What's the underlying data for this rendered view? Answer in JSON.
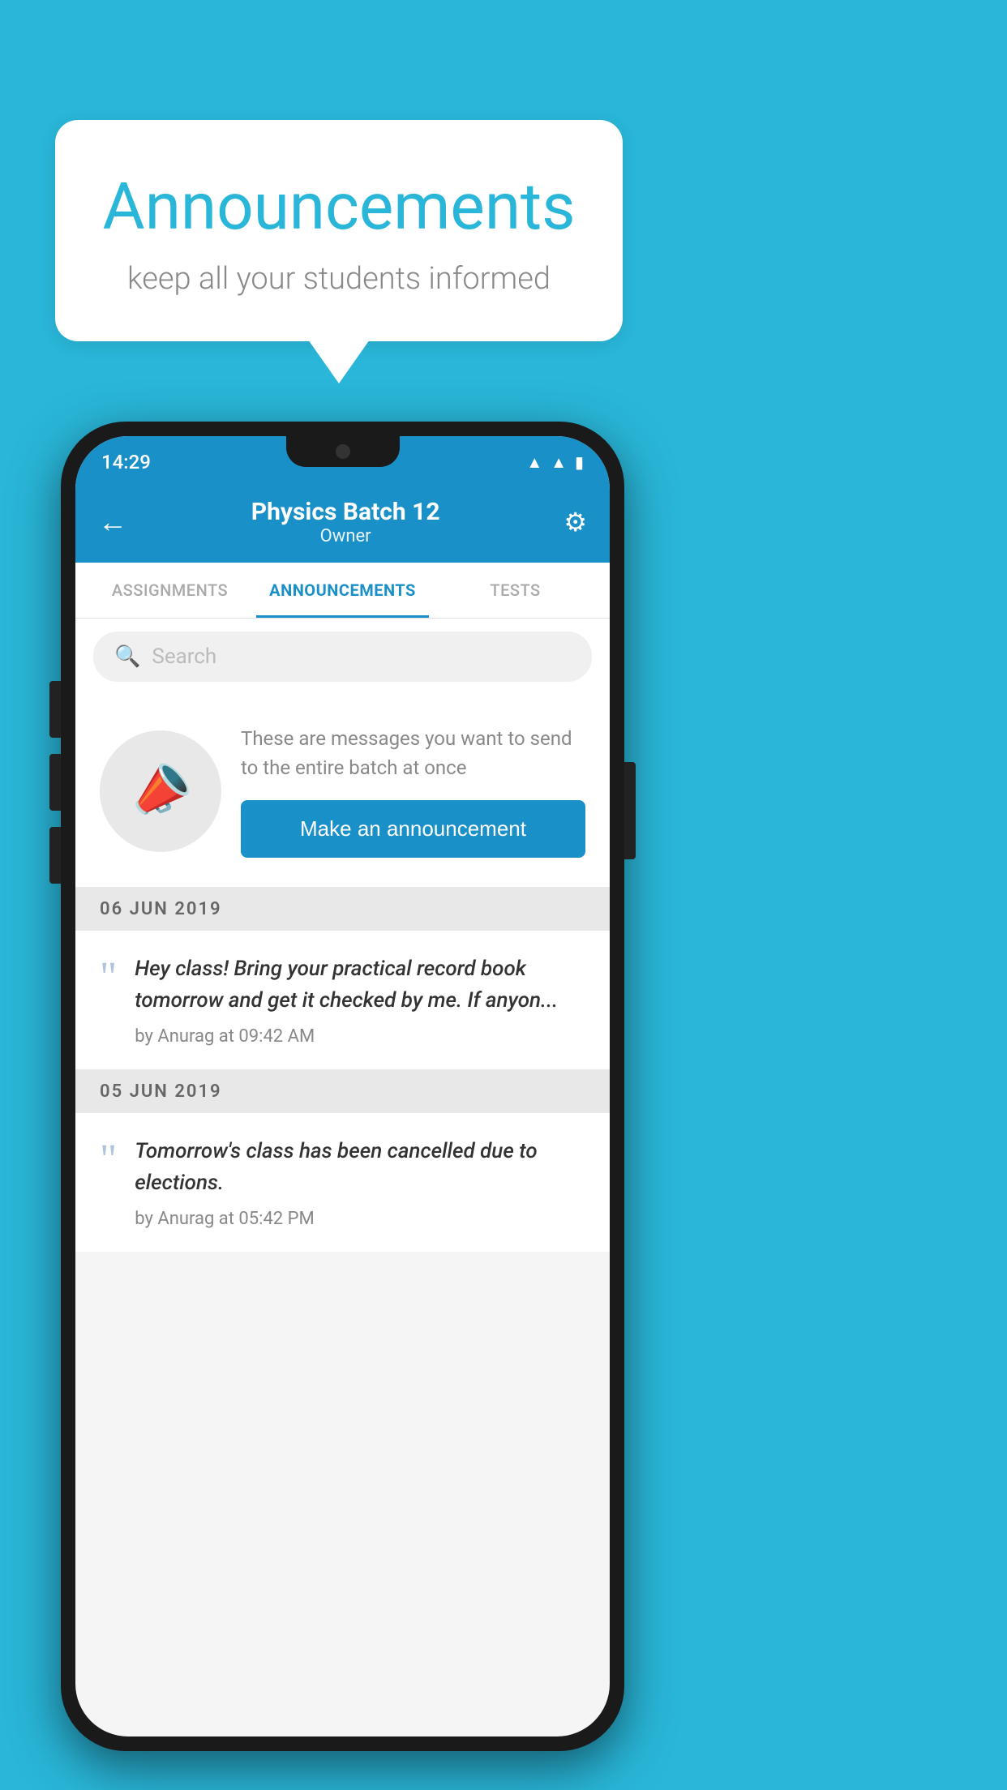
{
  "page": {
    "background_color": "#29B6D8"
  },
  "speech_bubble": {
    "title": "Announcements",
    "subtitle": "keep all your students informed"
  },
  "phone": {
    "status_bar": {
      "time": "14:29",
      "icons": [
        "wifi",
        "signal",
        "battery"
      ]
    },
    "header": {
      "back_label": "←",
      "title": "Physics Batch 12",
      "subtitle": "Owner",
      "settings_icon": "⚙"
    },
    "tabs": [
      {
        "label": "ASSIGNMENTS",
        "active": false
      },
      {
        "label": "ANNOUNCEMENTS",
        "active": true
      },
      {
        "label": "TESTS",
        "active": false
      }
    ],
    "search": {
      "placeholder": "Search"
    },
    "promo": {
      "description": "These are messages you want to send to the entire batch at once",
      "button_label": "Make an announcement"
    },
    "announcements": [
      {
        "date": "06  JUN  2019",
        "text": "Hey class! Bring your practical record book tomorrow and get it checked by me. If anyon...",
        "meta": "by Anurag at 09:42 AM"
      },
      {
        "date": "05  JUN  2019",
        "text": "Tomorrow's class has been cancelled due to elections.",
        "meta": "by Anurag at 05:42 PM"
      }
    ]
  }
}
